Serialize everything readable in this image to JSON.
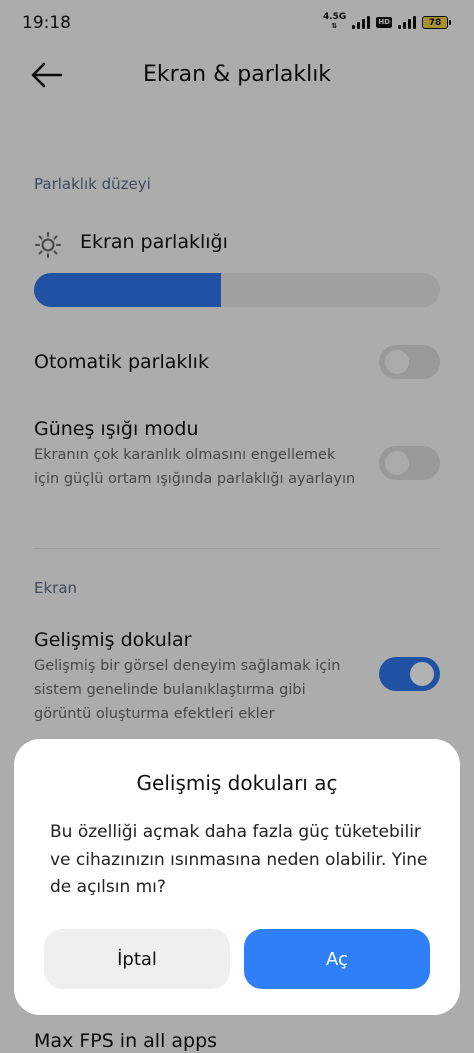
{
  "status_bar": {
    "time": "19:18",
    "network": "4.5G",
    "volte": "HD",
    "battery": "78"
  },
  "header": {
    "title": "Ekran & parlaklık"
  },
  "brightness_section": {
    "label": "Parlaklık düzeyi",
    "brightness_title": "Ekran parlaklığı",
    "brightness_level": 0.46,
    "auto": {
      "title": "Otomatik parlaklık",
      "enabled": false
    },
    "sunlight": {
      "title": "Güneş ışığı modu",
      "description": "Ekranın çok karanlık olmasını engellemek için güçlü ortam ışığında parlaklığı ayarlayın",
      "enabled": false
    }
  },
  "screen_section": {
    "label": "Ekran",
    "advanced_textures": {
      "title": "Gelişmiş dokular",
      "description": "Gelişmiş bir görsel deneyim sağlamak için sistem genelinde bulanıklaştırma gibi görüntü oluşturma efektleri ekler",
      "enabled": true
    },
    "max_fps": {
      "title": "Max FPS in all apps"
    }
  },
  "dialog": {
    "title": "Gelişmiş dokuları aç",
    "message": "Bu özelliği açmak daha fazla güç tüketebilir ve cihazınızın ısınmasına neden olabilir. Yine de açılsın mı?",
    "cancel_label": "İptal",
    "confirm_label": "Aç"
  },
  "colors": {
    "accent": "#2f74e8",
    "confirm": "#2f80f8",
    "background": "#f7f7f7",
    "scrim": "rgba(0,0,0,0.30)"
  },
  "icons": [
    "back-arrow-icon",
    "sun-icon",
    "signal-icon",
    "battery-icon"
  ]
}
